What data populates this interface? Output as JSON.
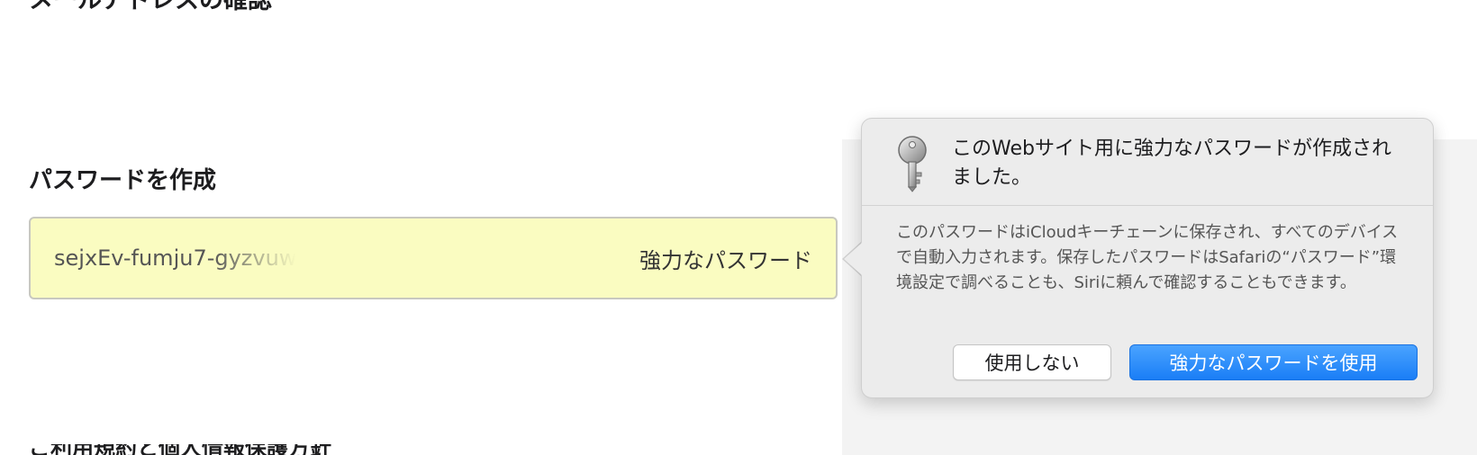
{
  "page": {
    "top_heading": "メールアドレスの確認",
    "section_title": "パスワードを作成",
    "bottom_cut_text": "ご利用規約と個人情報保護方針"
  },
  "password_field": {
    "value": "sejxEv-fumju7-gyzvuw",
    "strength_label": "強力なパスワード",
    "background_color": "#fafcc1"
  },
  "popover": {
    "icon": "key-icon",
    "title": "このWebサイト用に強力なパスワードが作成されました。",
    "description": "このパスワードはiCloudキーチェーンに保存され、すべてのデバイスで自動入力されます。保存したパスワードはSafariの“パスワード”環境設定で調べることも、Siriに頼んで確認することもできます。",
    "buttons": {
      "dont_use": "使用しない",
      "use_strong": "強力なパスワードを使用"
    },
    "primary_color": "#1a7ef6"
  }
}
